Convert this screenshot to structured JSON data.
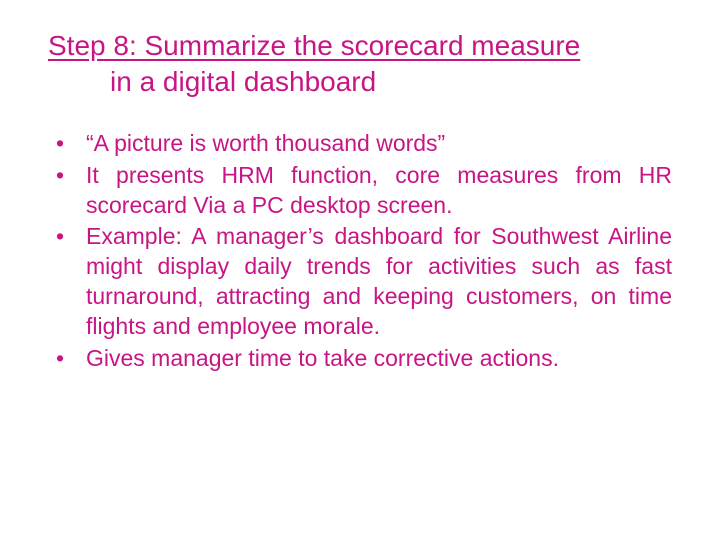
{
  "title_line1": "Step 8: Summarize the scorecard measure",
  "title_line2": "in a digital dashboard",
  "bullets": [
    "“A picture is worth thousand words”",
    "It presents HRM function, core measures from HR scorecard Via a PC desktop screen.",
    "Example: A manager’s dashboard for Southwest Airline might display daily trends for activities such as fast turnaround, attracting and keeping customers, on time flights and employee morale.",
    "Gives manager time to take corrective actions."
  ]
}
